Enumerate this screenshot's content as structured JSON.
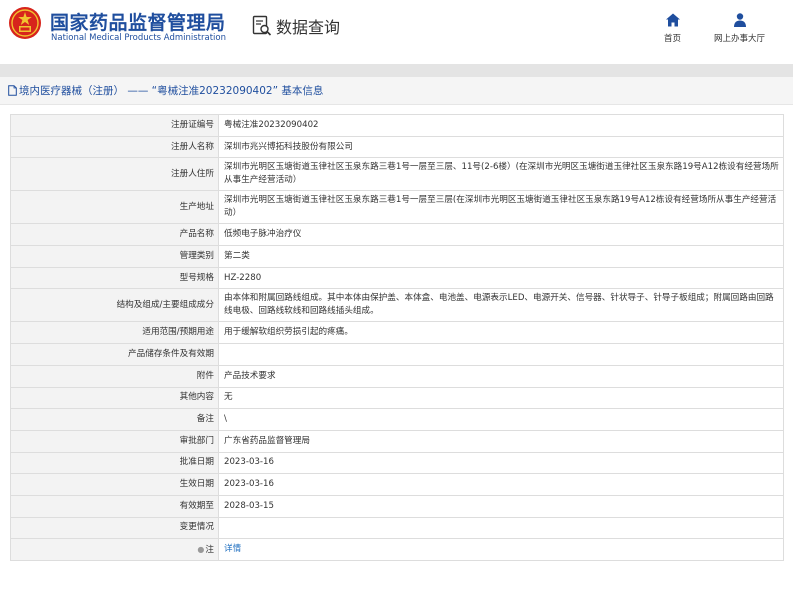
{
  "header": {
    "org_cn": "国家药品监督管理局",
    "org_en": "National Medical Products Administration",
    "data_query": "数据查询",
    "nav": [
      {
        "label": "首页",
        "icon": "home-icon"
      },
      {
        "label": "网上办事大厅",
        "icon": "user-service-icon"
      }
    ]
  },
  "breadcrumb": {
    "text": "境内医疗器械（注册） —— “粤械注准20232090402” 基本信息"
  },
  "colors": {
    "brand_blue": "#1f4e9e",
    "label_bg": "#f3f3f3",
    "border": "#dddddd",
    "emblem_red": "#d7241c",
    "emblem_gold": "#f2c230"
  },
  "table": {
    "rows": [
      {
        "label": "注册证编号",
        "value": "粤械注准20232090402"
      },
      {
        "label": "注册人名称",
        "value": "深圳市兆兴博拓科技股份有限公司"
      },
      {
        "label": "注册人住所",
        "value": "深圳市光明区玉塘街道玉律社区玉泉东路三巷1号一层至三层、11号(2-6楼）(在深圳市光明区玉塘街道玉律社区玉泉东路19号A12栋设有经营场所从事生产经营活动）"
      },
      {
        "label": "生产地址",
        "value": "深圳市光明区玉塘街道玉律社区玉泉东路三巷1号一层至三层(在深圳市光明区玉塘街道玉律社区玉泉东路19号A12栋设有经营场所从事生产经营活动）"
      },
      {
        "label": "产品名称",
        "value": "低频电子脉冲治疗仪"
      },
      {
        "label": "管理类别",
        "value": "第二类"
      },
      {
        "label": "型号规格",
        "value": "HZ-2280"
      },
      {
        "label": "结构及组成/主要组成成分",
        "value": "由本体和附属回路线组成。其中本体由保护盖、本体盒、电池盖、电源表示LED、电源开关、信号器、针状导子、针导子板组成；附属回路由回路线电极、回路线软线和回路线插头组成。"
      },
      {
        "label": "适用范围/预期用途",
        "value": "用于缓解软组织劳损引起的疼痛。"
      },
      {
        "label": "产品储存条件及有效期",
        "value": ""
      },
      {
        "label": "附件",
        "value": "产品技术要求"
      },
      {
        "label": "其他内容",
        "value": "无"
      },
      {
        "label": "备注",
        "value": "\\"
      },
      {
        "label": "审批部门",
        "value": "广东省药品监督管理局"
      },
      {
        "label": "批准日期",
        "value": "2023-03-16"
      },
      {
        "label": "生效日期",
        "value": "2023-03-16"
      },
      {
        "label": "有效期至",
        "value": "2028-03-15"
      },
      {
        "label": "变更情况",
        "value": ""
      },
      {
        "label": "注",
        "value": "详情",
        "pin": "●"
      }
    ]
  }
}
